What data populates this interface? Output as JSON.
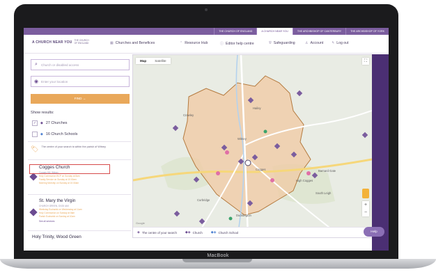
{
  "device": {
    "label": "MacBook"
  },
  "topnav": {
    "items": [
      {
        "label": "THE CHURCH OF ENGLAND",
        "active": false
      },
      {
        "label": "A CHURCH NEAR YOU",
        "active": true
      },
      {
        "label": "THE ARCHBISHOP OF CANTERBURY",
        "active": false
      },
      {
        "label": "THE ARCHBISHOP OF YORK",
        "active": false
      }
    ]
  },
  "header": {
    "logo": {
      "mark": "A CHURCH NEAR YOU",
      "sub1": "THE CHURCH",
      "sub2": "OF ENGLAND"
    },
    "nav": [
      {
        "icon": "grid-icon",
        "label": "Churches and Benefices"
      },
      {
        "icon": "up-arrow-icon",
        "label": "Resource Hub"
      },
      {
        "icon": "info-icon",
        "label": "Editor help centre"
      },
      {
        "icon": "shield-icon",
        "label": "Safeguarding"
      },
      {
        "icon": "person-icon",
        "label": "Account"
      },
      {
        "icon": "exit-icon",
        "label": "Log out"
      }
    ]
  },
  "search": {
    "church_placeholder": "Church or disabled access",
    "location_placeholder": "Enter your location",
    "find_label": "FIND →"
  },
  "filters": {
    "heading": "Show results:",
    "items": [
      {
        "checked": true,
        "label": "27 Churches",
        "color": "#6b4b91"
      },
      {
        "checked": false,
        "label": "16 Church Schools",
        "color": "#4b7fd1"
      }
    ]
  },
  "parish_notice": {
    "text": "The centre of your search is within the parish of Witney"
  },
  "results": [
    {
      "name": "Cogges Church",
      "meta": "Cogges Hill, Witney",
      "services": [
        "Holy Communion BCP on Sunday at 8am",
        "Family Service on Sunday at 10:30am",
        "Morning Worship on Sunday at 10:30am"
      ]
    },
    {
      "name": "St. Mary the Virgin",
      "meta": "CHURCH GREEN, OX28 4AX",
      "services": [
        "Weekday Eucharist on Wednesday at 11am",
        "Holy Communion on Sunday at 8am",
        "Parish Eucharist on Sunday at 10am",
        "See all services"
      ]
    },
    {
      "name": "Holy Trinity, Wood Green",
      "meta": "",
      "services": []
    }
  ],
  "map": {
    "tabs": [
      {
        "label": "Map",
        "active": true
      },
      {
        "label": "Satellite",
        "active": false
      }
    ],
    "google_label": "Google",
    "place_labels": [
      "Curbridge",
      "Cogges",
      "High Cogges",
      "Ducklington",
      "Barnard Gate",
      "South Leigh",
      "Hailey",
      "Crawley",
      "Witney"
    ],
    "legend": [
      {
        "icon": "search-centre-icon",
        "label": "The centre of your search"
      },
      {
        "icon": "church-marker-icon",
        "label": "Church"
      },
      {
        "icon": "school-marker-icon",
        "label": "Church School"
      }
    ]
  },
  "help": {
    "label": "Help"
  },
  "colors": {
    "brand_purple": "#6b4b91",
    "find_orange": "#e9a85a",
    "parish_fill": "#f0c9a3"
  }
}
